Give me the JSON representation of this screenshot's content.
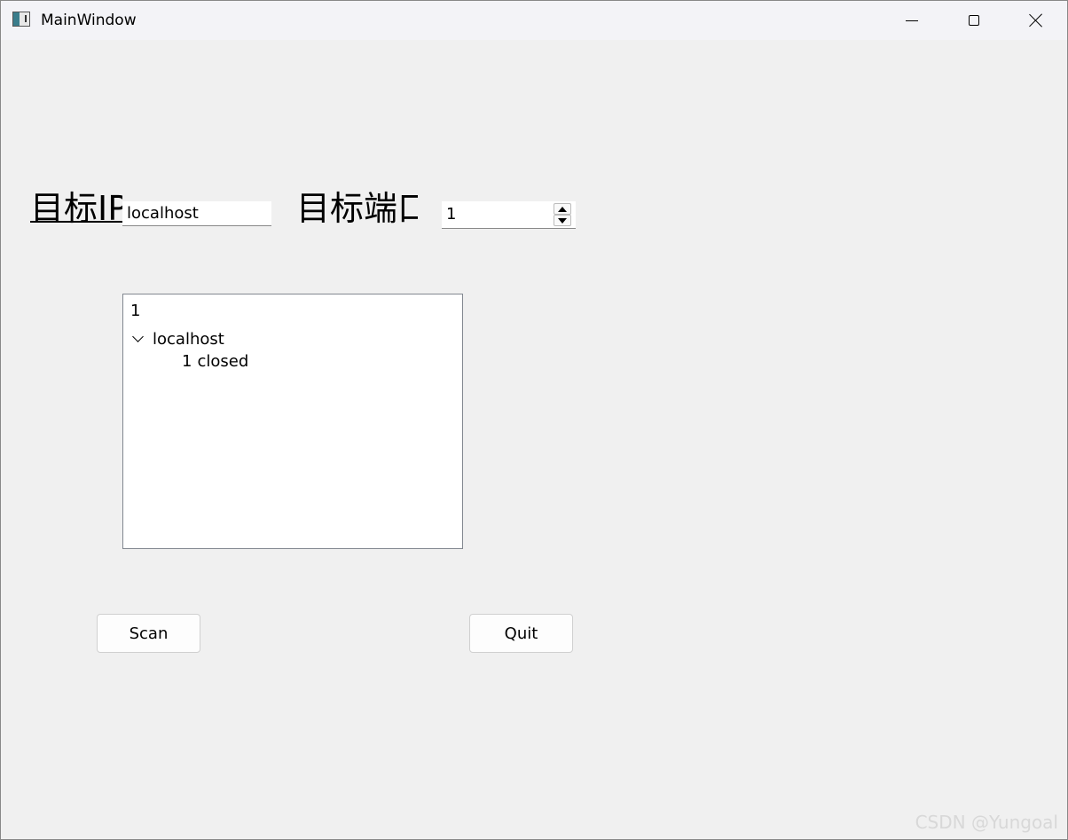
{
  "window": {
    "title": "MainWindow"
  },
  "form": {
    "ip_label": "目标IP",
    "ip_value": "localhost",
    "port_label": "目标端口",
    "port_value": "1"
  },
  "tree": {
    "header": "1",
    "items": [
      {
        "label": "localhost",
        "expanded": true,
        "children": [
          {
            "port": "1",
            "status": "closed"
          }
        ]
      }
    ]
  },
  "buttons": {
    "scan": "Scan",
    "quit": "Quit"
  },
  "watermark": "CSDN @Yungoal",
  "icons": {
    "minimize": "minimize-icon",
    "maximize": "maximize-icon",
    "close": "close-icon",
    "chevron": "chevron-down-icon",
    "spin_up": "arrow-up-icon",
    "spin_down": "arrow-down-icon"
  }
}
